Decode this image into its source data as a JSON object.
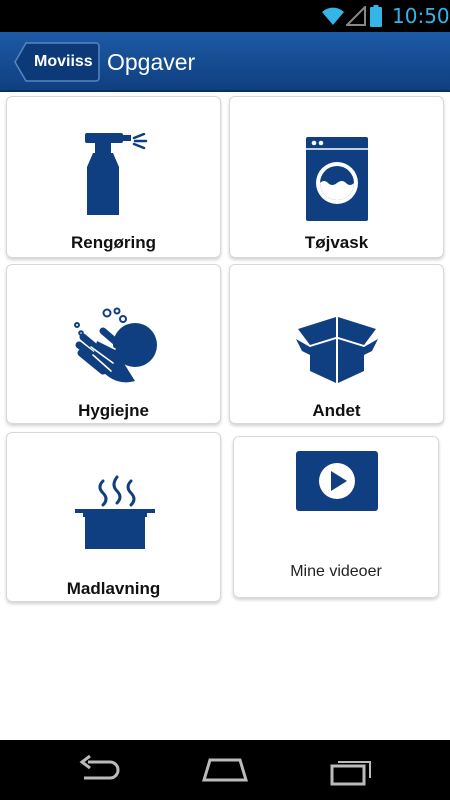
{
  "status_bar": {
    "time": "10:50",
    "icons": [
      "wifi-icon",
      "signal-icon",
      "battery-icon"
    ],
    "accent": "#33b5e5"
  },
  "header": {
    "back_label": "Moviiss",
    "title": "Opgaver",
    "color": "#1d5aa6"
  },
  "tiles": [
    {
      "label": "Rengøring",
      "icon": "spray-bottle-icon"
    },
    {
      "label": "Tøjvask",
      "icon": "washing-machine-icon"
    },
    {
      "label": "Hygiejne",
      "icon": "washing-hands-icon"
    },
    {
      "label": "Andet",
      "icon": "open-box-icon"
    },
    {
      "label": "Madlavning",
      "icon": "cooking-pot-icon"
    },
    {
      "label": "Mine videoer",
      "icon": "play-video-icon"
    }
  ],
  "nav_bar": {
    "icons": [
      "back-nav-icon",
      "home-nav-icon",
      "recent-apps-icon"
    ]
  },
  "colors": {
    "icon_blue": "#0f3f80"
  }
}
